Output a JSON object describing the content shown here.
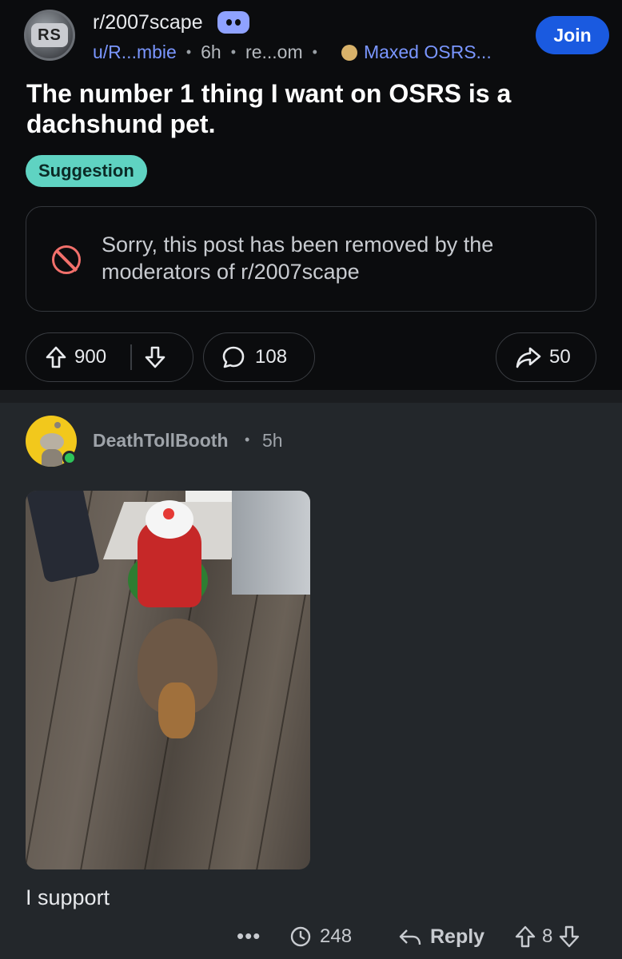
{
  "post": {
    "subreddit": "r/2007scape",
    "author": "u/R...mbie",
    "age": "6h",
    "domain": "re...om",
    "user_flair": "Maxed OSRS...",
    "join_label": "Join",
    "title": "The number 1 thing I want on OSRS is a dachshund pet.",
    "post_flair": "Suggestion",
    "removed_message": "Sorry, this post has been removed by the moderators of r/2007scape",
    "upvotes": "900",
    "comments": "108",
    "shares": "50",
    "subreddit_icon_text": "RS"
  },
  "comment": {
    "username": "DeathTollBooth",
    "age": "5h",
    "text": "I support",
    "more_label": "•••",
    "awards": "248",
    "reply_label": "Reply",
    "votes": "8"
  },
  "icons": {
    "subreddit_avatar": "runescape-logo-icon",
    "discord": "discord-icon",
    "flair_icon": "maxed-cape-icon",
    "removed": "ban-icon",
    "upvote": "upvote-arrow-icon",
    "downvote": "downvote-arrow-icon",
    "comment": "comment-bubble-icon",
    "share": "share-arrow-icon",
    "award": "award-icon",
    "reply": "reply-arrow-icon"
  },
  "colors": {
    "join_button": "#1a5ae0",
    "flair_bg": "#5fd3c2",
    "link_blue": "#7a96ff",
    "ban_red": "#f2706b",
    "online_green": "#2ec45a",
    "avatar_yellow": "#f2c81c"
  }
}
